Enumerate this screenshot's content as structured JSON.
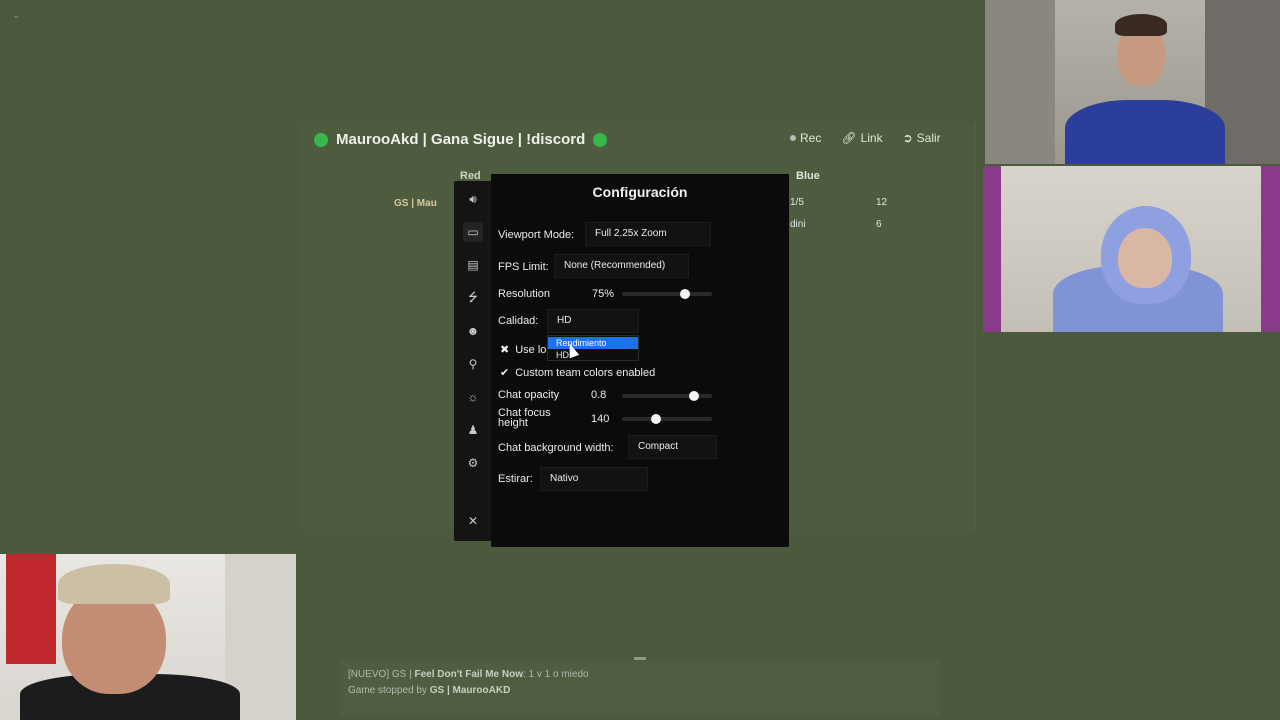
{
  "room": {
    "title": "MaurooAkd | Gana Sigue | !discord",
    "actions": {
      "rec": "Rec",
      "link": "Link",
      "exit": "Salir"
    },
    "teams": {
      "red": "Red",
      "blue": "Blue"
    },
    "red_player": "GS | Mau",
    "blue_rows": [
      {
        "name": "1/5",
        "score": "12"
      },
      {
        "name": "dini",
        "score": "6"
      }
    ]
  },
  "settings": {
    "title": "Configuración",
    "sidebar_icons": [
      "speaker-icon",
      "monitor-icon",
      "display-icon",
      "bolt-icon",
      "user-icon",
      "key-icon",
      "sun-icon",
      "add-user-icon",
      "gear-icon"
    ],
    "close_label": "✕",
    "viewport": {
      "label": "Viewport Mode:",
      "value": "Full 2.25x Zoom"
    },
    "fps": {
      "label": "FPS Limit:",
      "value": "None (Recommended)"
    },
    "resolution": {
      "label": "Resolution",
      "value": "75%",
      "level": 0.7
    },
    "calidad": {
      "label": "Calidad:",
      "value": "HD",
      "options": [
        "Rendimiento",
        "HD"
      ],
      "selected": "Rendimiento"
    },
    "use_lo": {
      "label": "Use lo",
      "checked": false
    },
    "custom_colors": {
      "label": "Custom team colors enabled",
      "checked": true
    },
    "chat_opacity": {
      "label": "Chat opacity",
      "value": "0.8",
      "level": 0.8
    },
    "chat_focus": {
      "label": "Chat focus height",
      "value": "140",
      "level": 0.38
    },
    "chat_bg": {
      "label": "Chat background width:",
      "value": "Compact"
    },
    "estirar": {
      "label": "Estirar:",
      "value": "Nativo"
    }
  },
  "chat": {
    "line1_prefix": "[NUEVO] GS | ",
    "line1_bold": "Feel Don't Fail Me Now",
    "line1_rest": ": 1 v 1 o miedo",
    "line2_prefix": "Game stopped by ",
    "line2_bold": "GS | MaurooAKD"
  }
}
